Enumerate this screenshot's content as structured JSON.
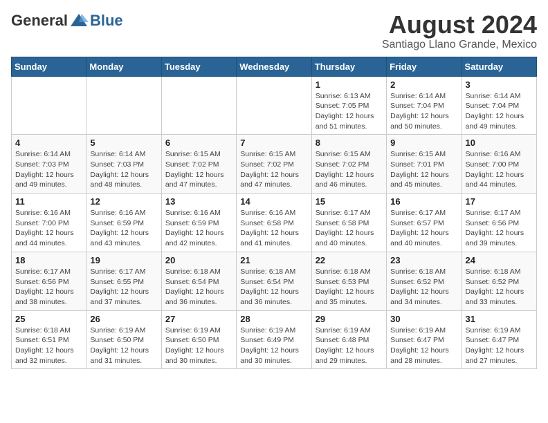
{
  "header": {
    "logo_general": "General",
    "logo_blue": "Blue",
    "month_year": "August 2024",
    "location": "Santiago Llano Grande, Mexico"
  },
  "days_of_week": [
    "Sunday",
    "Monday",
    "Tuesday",
    "Wednesday",
    "Thursday",
    "Friday",
    "Saturday"
  ],
  "weeks": [
    [
      {
        "day": "",
        "info": ""
      },
      {
        "day": "",
        "info": ""
      },
      {
        "day": "",
        "info": ""
      },
      {
        "day": "",
        "info": ""
      },
      {
        "day": "1",
        "info": "Sunrise: 6:13 AM\nSunset: 7:05 PM\nDaylight: 12 hours\nand 51 minutes."
      },
      {
        "day": "2",
        "info": "Sunrise: 6:14 AM\nSunset: 7:04 PM\nDaylight: 12 hours\nand 50 minutes."
      },
      {
        "day": "3",
        "info": "Sunrise: 6:14 AM\nSunset: 7:04 PM\nDaylight: 12 hours\nand 49 minutes."
      }
    ],
    [
      {
        "day": "4",
        "info": "Sunrise: 6:14 AM\nSunset: 7:03 PM\nDaylight: 12 hours\nand 49 minutes."
      },
      {
        "day": "5",
        "info": "Sunrise: 6:14 AM\nSunset: 7:03 PM\nDaylight: 12 hours\nand 48 minutes."
      },
      {
        "day": "6",
        "info": "Sunrise: 6:15 AM\nSunset: 7:02 PM\nDaylight: 12 hours\nand 47 minutes."
      },
      {
        "day": "7",
        "info": "Sunrise: 6:15 AM\nSunset: 7:02 PM\nDaylight: 12 hours\nand 47 minutes."
      },
      {
        "day": "8",
        "info": "Sunrise: 6:15 AM\nSunset: 7:02 PM\nDaylight: 12 hours\nand 46 minutes."
      },
      {
        "day": "9",
        "info": "Sunrise: 6:15 AM\nSunset: 7:01 PM\nDaylight: 12 hours\nand 45 minutes."
      },
      {
        "day": "10",
        "info": "Sunrise: 6:16 AM\nSunset: 7:00 PM\nDaylight: 12 hours\nand 44 minutes."
      }
    ],
    [
      {
        "day": "11",
        "info": "Sunrise: 6:16 AM\nSunset: 7:00 PM\nDaylight: 12 hours\nand 44 minutes."
      },
      {
        "day": "12",
        "info": "Sunrise: 6:16 AM\nSunset: 6:59 PM\nDaylight: 12 hours\nand 43 minutes."
      },
      {
        "day": "13",
        "info": "Sunrise: 6:16 AM\nSunset: 6:59 PM\nDaylight: 12 hours\nand 42 minutes."
      },
      {
        "day": "14",
        "info": "Sunrise: 6:16 AM\nSunset: 6:58 PM\nDaylight: 12 hours\nand 41 minutes."
      },
      {
        "day": "15",
        "info": "Sunrise: 6:17 AM\nSunset: 6:58 PM\nDaylight: 12 hours\nand 40 minutes."
      },
      {
        "day": "16",
        "info": "Sunrise: 6:17 AM\nSunset: 6:57 PM\nDaylight: 12 hours\nand 40 minutes."
      },
      {
        "day": "17",
        "info": "Sunrise: 6:17 AM\nSunset: 6:56 PM\nDaylight: 12 hours\nand 39 minutes."
      }
    ],
    [
      {
        "day": "18",
        "info": "Sunrise: 6:17 AM\nSunset: 6:56 PM\nDaylight: 12 hours\nand 38 minutes."
      },
      {
        "day": "19",
        "info": "Sunrise: 6:17 AM\nSunset: 6:55 PM\nDaylight: 12 hours\nand 37 minutes."
      },
      {
        "day": "20",
        "info": "Sunrise: 6:18 AM\nSunset: 6:54 PM\nDaylight: 12 hours\nand 36 minutes."
      },
      {
        "day": "21",
        "info": "Sunrise: 6:18 AM\nSunset: 6:54 PM\nDaylight: 12 hours\nand 36 minutes."
      },
      {
        "day": "22",
        "info": "Sunrise: 6:18 AM\nSunset: 6:53 PM\nDaylight: 12 hours\nand 35 minutes."
      },
      {
        "day": "23",
        "info": "Sunrise: 6:18 AM\nSunset: 6:52 PM\nDaylight: 12 hours\nand 34 minutes."
      },
      {
        "day": "24",
        "info": "Sunrise: 6:18 AM\nSunset: 6:52 PM\nDaylight: 12 hours\nand 33 minutes."
      }
    ],
    [
      {
        "day": "25",
        "info": "Sunrise: 6:18 AM\nSunset: 6:51 PM\nDaylight: 12 hours\nand 32 minutes."
      },
      {
        "day": "26",
        "info": "Sunrise: 6:19 AM\nSunset: 6:50 PM\nDaylight: 12 hours\nand 31 minutes."
      },
      {
        "day": "27",
        "info": "Sunrise: 6:19 AM\nSunset: 6:50 PM\nDaylight: 12 hours\nand 30 minutes."
      },
      {
        "day": "28",
        "info": "Sunrise: 6:19 AM\nSunset: 6:49 PM\nDaylight: 12 hours\nand 30 minutes."
      },
      {
        "day": "29",
        "info": "Sunrise: 6:19 AM\nSunset: 6:48 PM\nDaylight: 12 hours\nand 29 minutes."
      },
      {
        "day": "30",
        "info": "Sunrise: 6:19 AM\nSunset: 6:47 PM\nDaylight: 12 hours\nand 28 minutes."
      },
      {
        "day": "31",
        "info": "Sunrise: 6:19 AM\nSunset: 6:47 PM\nDaylight: 12 hours\nand 27 minutes."
      }
    ]
  ]
}
